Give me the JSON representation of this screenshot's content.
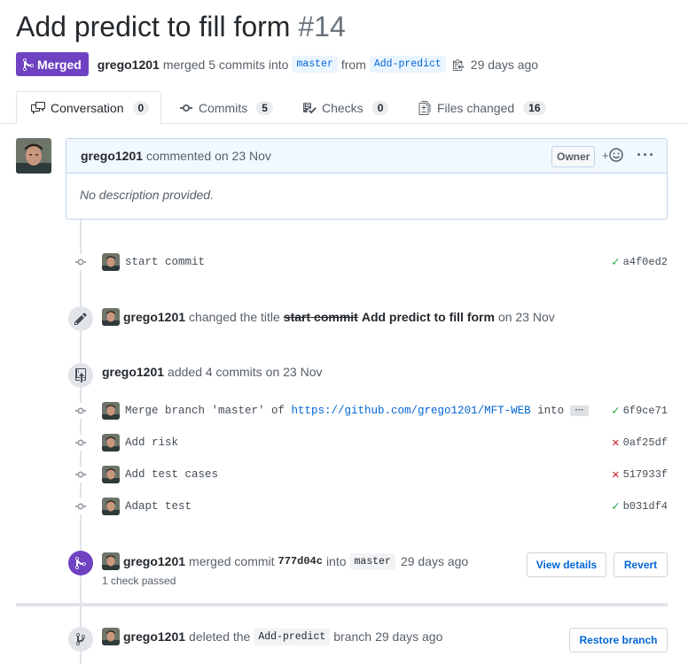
{
  "pr": {
    "title": "Add predict to fill form",
    "number": "#14",
    "state": "Merged",
    "author": "grego1201",
    "action": "merged 5 commits into",
    "base_branch": "master",
    "from": "from",
    "head_branch": "Add-predict",
    "time": "29 days ago"
  },
  "tabs": [
    {
      "label": "Conversation",
      "count": "0"
    },
    {
      "label": "Commits",
      "count": "5"
    },
    {
      "label": "Checks",
      "count": "0"
    },
    {
      "label": "Files changed",
      "count": "16"
    }
  ],
  "comment": {
    "author": "grego1201",
    "action": "commented on 23 Nov",
    "badge": "Owner",
    "body": "No description provided."
  },
  "commits_first": [
    {
      "message": "start commit",
      "sha": "a4f0ed2",
      "status": "success"
    }
  ],
  "title_change": {
    "author": "grego1201",
    "action": "changed the title",
    "old": "start commit",
    "new": "Add predict to fill form",
    "time": "on 23 Nov"
  },
  "added_commits": {
    "author": "grego1201",
    "action": "added 4 commits",
    "time": "on 23 Nov"
  },
  "commits": [
    {
      "message_prefix": "Merge branch 'master' of ",
      "link": "https://github.com/grego1201/MFT-WEB",
      "message_suffix": " into Ad…",
      "sha": "6f9ce71",
      "status": "success"
    },
    {
      "message_prefix": "Add risk",
      "link": "",
      "message_suffix": "",
      "sha": "0af25df",
      "status": "failure"
    },
    {
      "message_prefix": "Add test cases",
      "link": "",
      "message_suffix": "",
      "sha": "517933f",
      "status": "failure"
    },
    {
      "message_prefix": "Adapt test",
      "link": "",
      "message_suffix": "",
      "sha": "b031df4",
      "status": "success"
    }
  ],
  "merge_event": {
    "author": "grego1201",
    "action": "merged commit",
    "sha": "777d04c",
    "into": "into",
    "branch": "master",
    "time": "29 days ago",
    "checks": "1 check passed",
    "view_details": "View details",
    "revert": "Revert"
  },
  "delete_event": {
    "author": "grego1201",
    "action": "deleted the",
    "branch": "Add-predict",
    "suffix": "branch",
    "time": "29 days ago",
    "restore": "Restore branch"
  },
  "colors": {
    "merged": "#6f42c1",
    "link": "#0366d6",
    "success": "#28a745",
    "failure": "#cb2431"
  }
}
